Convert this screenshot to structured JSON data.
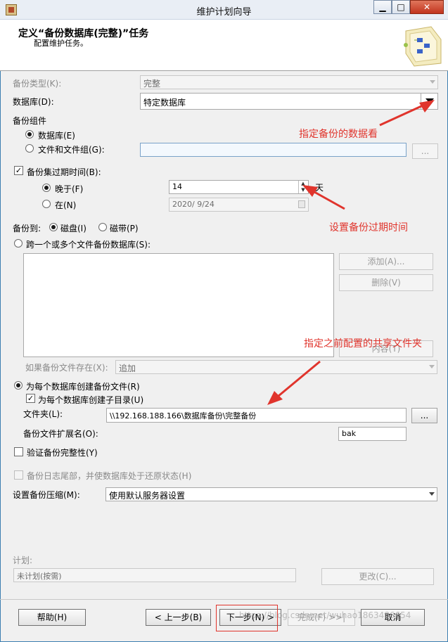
{
  "window": {
    "title": "维护计划向导",
    "minimize": "▁",
    "maximize": "□",
    "close": "✕"
  },
  "header": {
    "title": "定义“备份数据库(完整)”任务",
    "subtitle": "配置维护任务。"
  },
  "backup_type": {
    "label": "备份类型(K):",
    "value": "完整"
  },
  "database": {
    "label": "数据库(D):",
    "value": "特定数据库"
  },
  "component": {
    "group_label": "备份组件",
    "database_option": "数据库(E)",
    "files_option": "文件和文件组(G):",
    "browse_label": "..."
  },
  "expiry": {
    "check_label": "备份集过期时间(B):",
    "after_option": "晚于(F)",
    "after_value": "14",
    "unit": "天",
    "on_option": "在(N)",
    "date_value": "2020/ 9/24"
  },
  "backup_to": {
    "label": "备份到:",
    "disk": "磁盘(I)",
    "tape": "磁带(P)"
  },
  "span_files": {
    "option": "跨一个或多个文件备份数据库(S):",
    "add": "添加(A)...",
    "delete": "删除(V)",
    "contents": "内容(T)"
  },
  "if_exists": {
    "label": "如果备份文件存在(X):",
    "value": "追加"
  },
  "per_db": {
    "option": "为每个数据库创建备份文件(R)",
    "subdir": "为每个数据库创建子目录(U)",
    "folder_label": "文件夹(L):",
    "folder_value": "\\\\192.168.188.166\\数据库备份\\完整备份",
    "folder_browse": "...",
    "ext_label": "备份文件扩展名(O):",
    "ext_value": "bak"
  },
  "verify": {
    "label": "验证备份完整性(Y)"
  },
  "tail": {
    "label": "备份日志尾部，并使数据库处于还原状态(H)"
  },
  "compression": {
    "label": "设置备份压缩(M):",
    "value": "使用默认服务器设置"
  },
  "schedule": {
    "label": "计划:",
    "value": "未计划(按需)",
    "change": "更改(C)..."
  },
  "footer": {
    "help": "帮助(H)",
    "back": "< 上一步(B)",
    "next": "下一步(N) >",
    "finish": "完成(F) >>|",
    "cancel": "取消"
  },
  "annotations": {
    "database_note": "指定备份的数据看",
    "expiry_note": "设置备份过期时间",
    "folder_note": "指定之前配置的共享文件夹"
  },
  "watermark": "https://blog.csdn.net/wuhao1863486654",
  "colors": {
    "annotation": "#e0342c",
    "highlight_box": "#e0342c"
  }
}
